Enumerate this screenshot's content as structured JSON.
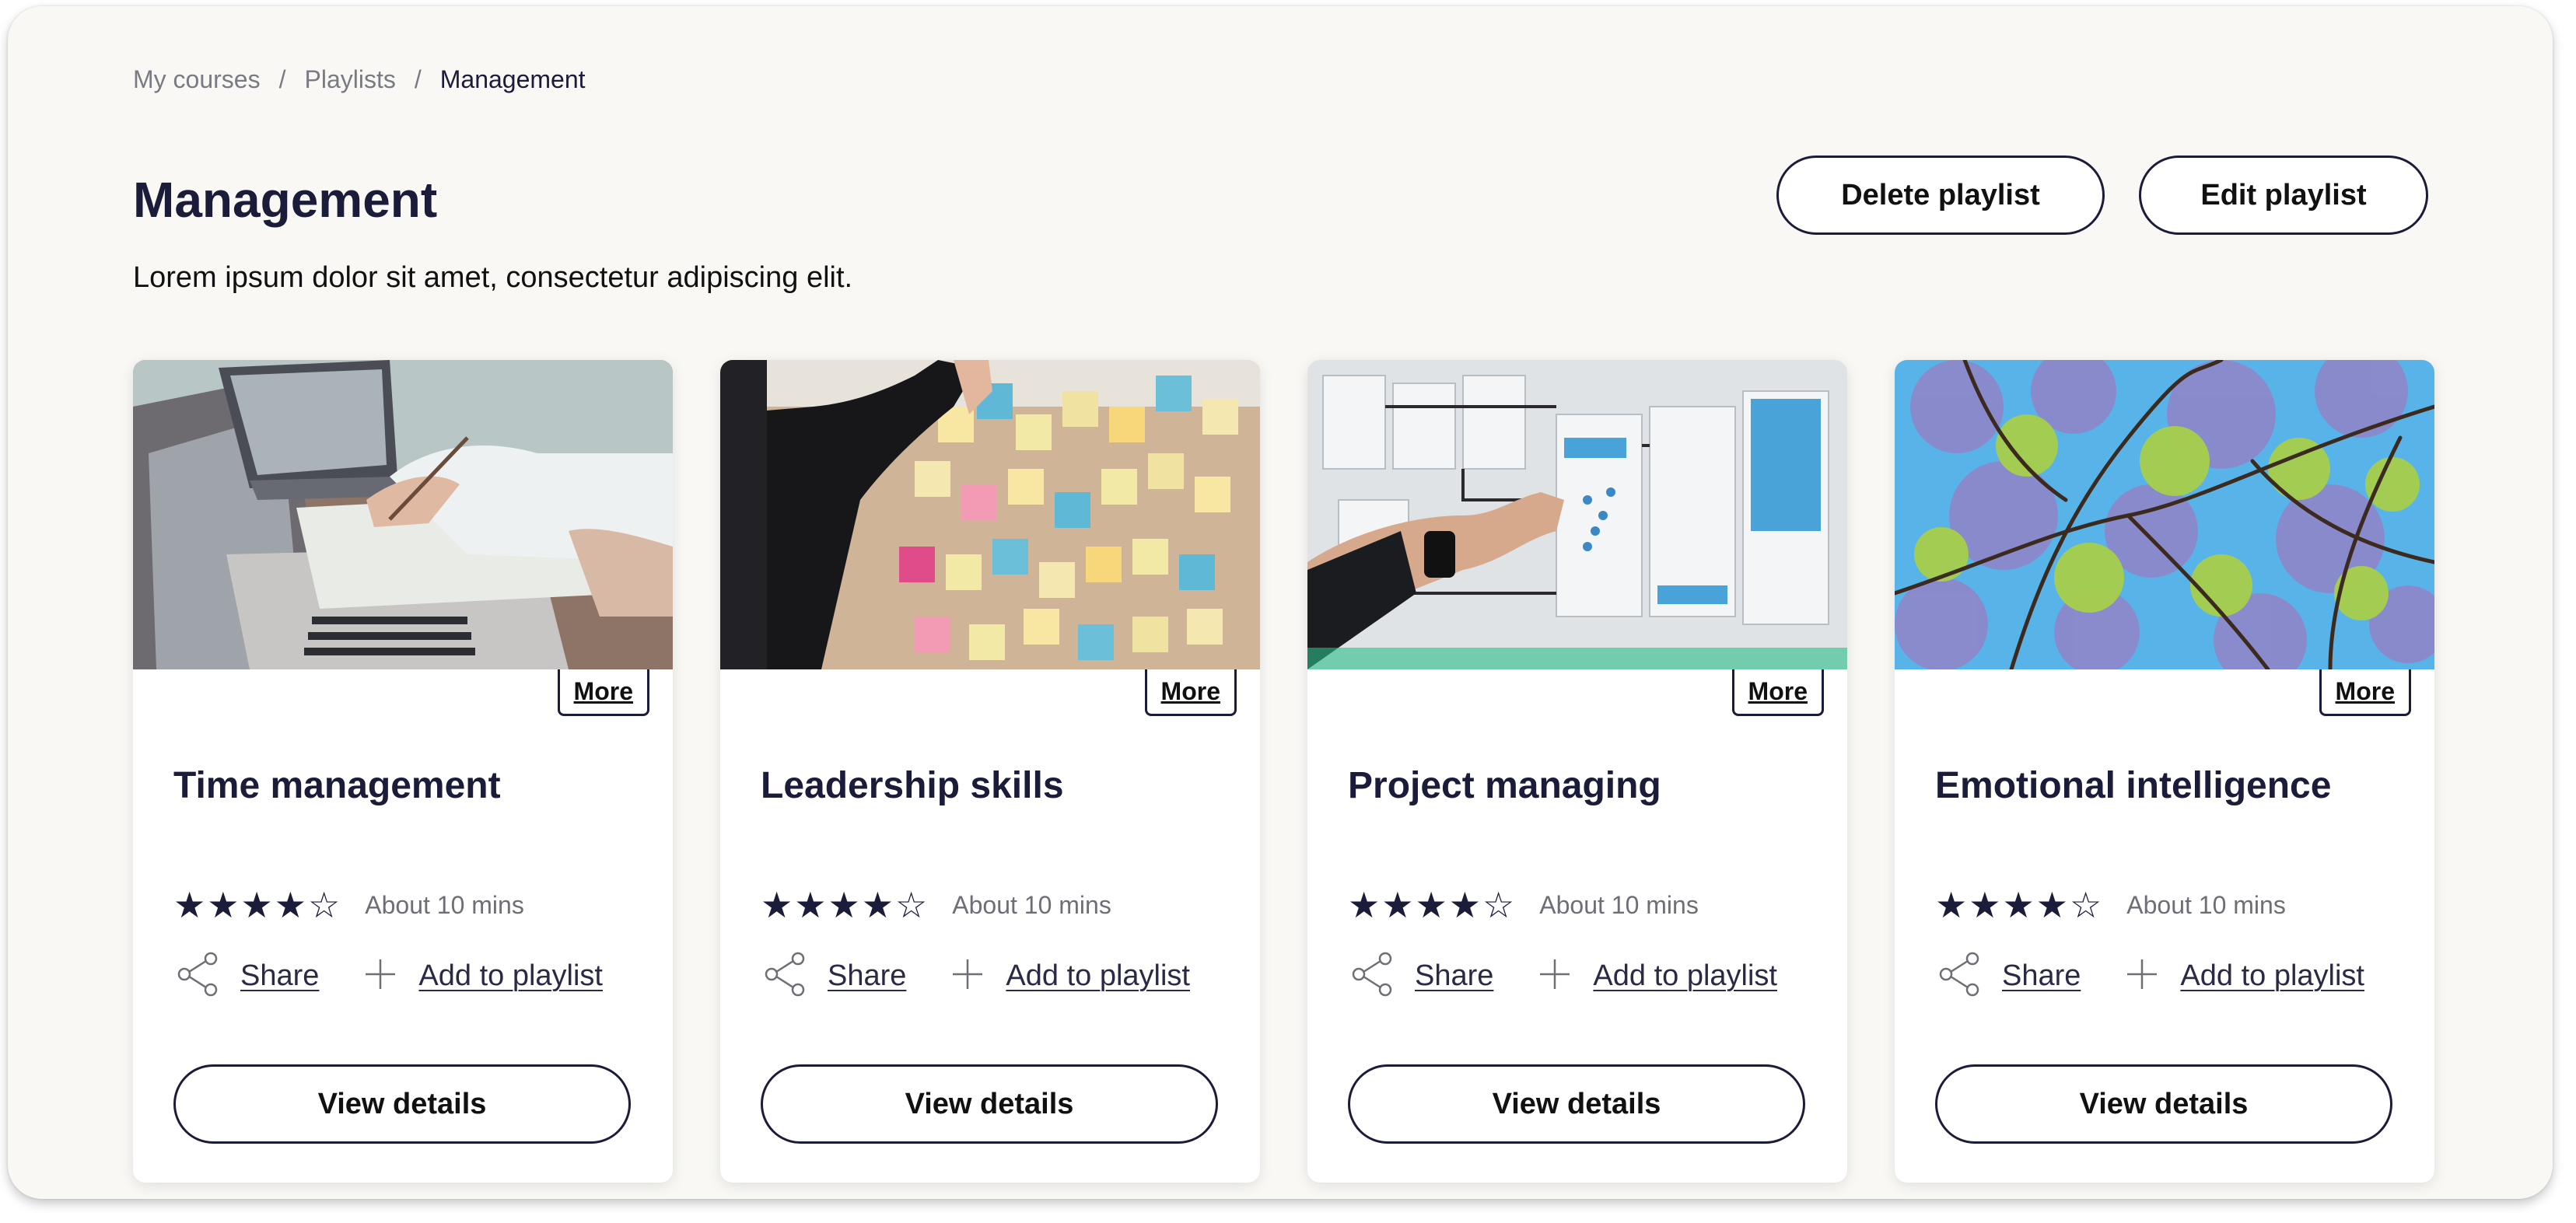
{
  "breadcrumb": {
    "items": [
      "My courses",
      "Playlists"
    ],
    "current": "Management",
    "separator": "/"
  },
  "page": {
    "title": "Management",
    "description": "Lorem ipsum dolor sit amet, consectetur adipiscing elit."
  },
  "header_actions": {
    "delete_label": "Delete playlist",
    "edit_label": "Edit playlist"
  },
  "colors": {
    "accent": "#1b1b3a",
    "background": "#f9f8f5",
    "muted_text": "#6e6e76"
  },
  "cards": [
    {
      "title": "Time management",
      "image": "laptops-and-paperwork-photo",
      "rating": 4,
      "rating_max": 5,
      "duration": "About 10 mins",
      "more_label": "More",
      "share_label": "Share",
      "add_label": "Add to playlist",
      "view_label": "View details"
    },
    {
      "title": "Leadership skills",
      "image": "sticky-notes-board-photo",
      "rating": 4,
      "rating_max": 5,
      "duration": "About 10 mins",
      "more_label": "More",
      "share_label": "Share",
      "add_label": "Add to playlist",
      "view_label": "View details"
    },
    {
      "title": "Project managing",
      "image": "wireframe-wall-photo",
      "rating": 4,
      "rating_max": 5,
      "duration": "About 10 mins",
      "more_label": "More",
      "share_label": "Share",
      "add_label": "Add to playlist",
      "view_label": "View details"
    },
    {
      "title": "Emotional intelligence",
      "image": "jacaranda-tree-sky-photo",
      "rating": 4,
      "rating_max": 5,
      "duration": "About 10 mins",
      "more_label": "More",
      "share_label": "Share",
      "add_label": "Add to playlist",
      "view_label": "View details"
    }
  ]
}
